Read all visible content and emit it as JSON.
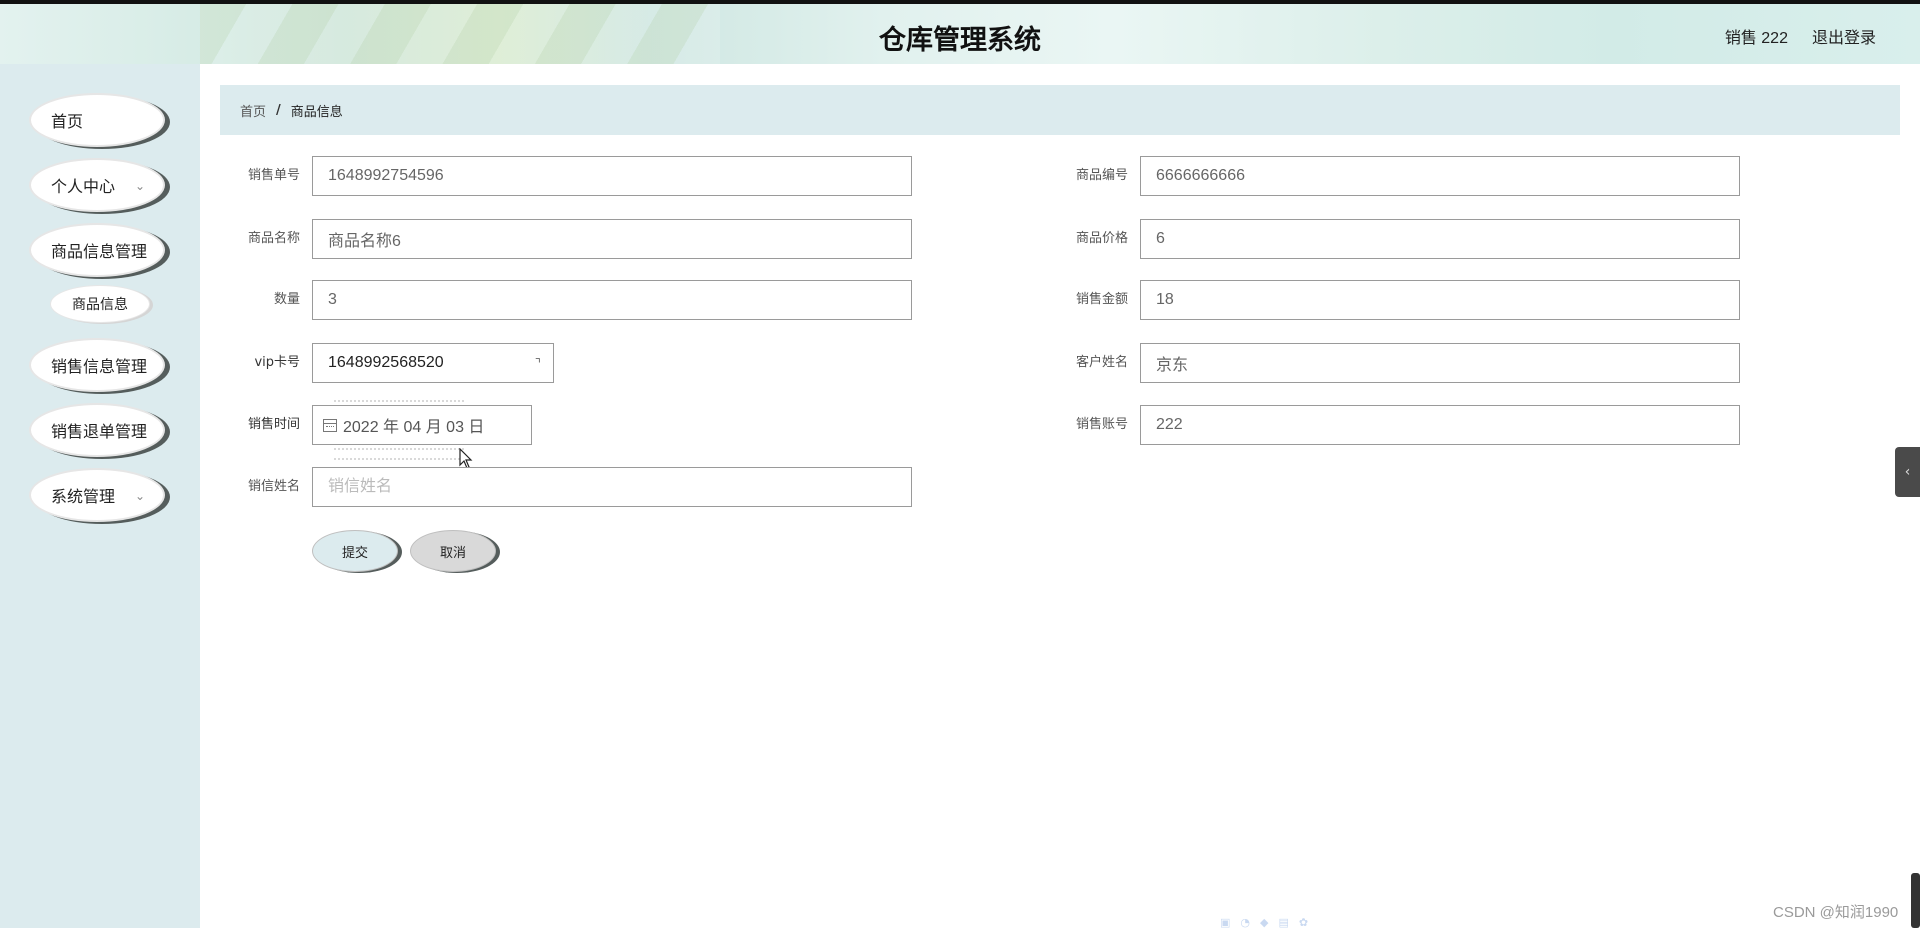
{
  "header": {
    "title": "仓库管理系统",
    "user": "销售 222",
    "logout": "退出登录"
  },
  "sidebar": {
    "items": [
      {
        "label": "首页",
        "has_children": false
      },
      {
        "label": "个人中心",
        "has_children": true
      },
      {
        "label": "商品信息管理",
        "has_children": false
      },
      {
        "label": "销售信息管理",
        "has_children": false
      },
      {
        "label": "销售退单管理",
        "has_children": false
      },
      {
        "label": "系统管理",
        "has_children": true
      }
    ],
    "subitem": "商品信息",
    "chevron": "⌄"
  },
  "breadcrumb": {
    "home": "首页",
    "separator": "/",
    "current": "商品信息"
  },
  "form": {
    "sale_no": {
      "label": "销售单号",
      "value": "1648992754596"
    },
    "product_code": {
      "label": "商品编号",
      "value": "6666666666"
    },
    "product_name": {
      "label": "商品名称",
      "value": "商品名称6"
    },
    "product_price": {
      "label": "商品价格",
      "value": "6"
    },
    "quantity": {
      "label": "数量",
      "value": "3"
    },
    "sale_amount": {
      "label": "销售金额",
      "value": "18"
    },
    "vip_card": {
      "label": "vip卡号",
      "value": "1648992568520"
    },
    "customer_name": {
      "label": "客户姓名",
      "value": "京东"
    },
    "sale_time": {
      "label": "销售时间",
      "value": "2022 年 04 月 03 日"
    },
    "sale_account": {
      "label": "销售账号",
      "value": "222"
    },
    "seller_name": {
      "label": "销信姓名",
      "placeholder": "销信姓名"
    }
  },
  "buttons": {
    "submit": "提交",
    "cancel": "取消"
  },
  "side_handle": "‹",
  "watermark": "CSDN @知润1990",
  "colors": {
    "sidebar_bg": "#dcebee",
    "breadcrumb_bg": "#dcebee",
    "menu_shadow": "#555d5c",
    "cancel_bg": "#d9d9d9"
  }
}
